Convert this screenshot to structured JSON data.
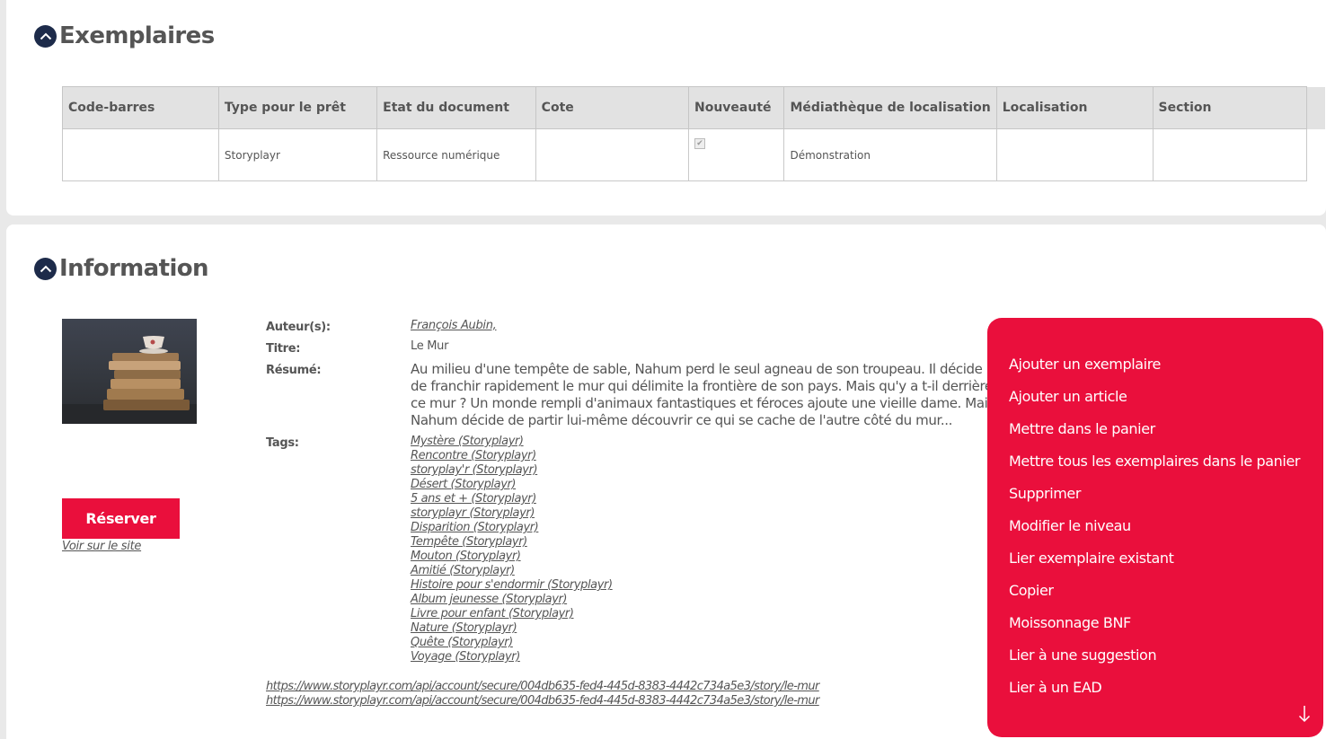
{
  "exemplaires": {
    "title": "Exemplaires",
    "columns": [
      "Code-barres",
      "Type pour le prêt",
      "Etat du document",
      "Cote",
      "Nouveauté",
      "Médiathèque de localisation",
      "Localisation",
      "Section"
    ],
    "rows": [
      {
        "code_barres": "",
        "type_pret": "Storyplayr",
        "etat": "Ressource numérique",
        "cote": "",
        "nouveaute_checked": true,
        "mediatheque": "Démonstration",
        "localisation": "",
        "section": ""
      }
    ]
  },
  "information": {
    "title": "Information",
    "labels": {
      "auteurs": "Auteur(s):",
      "titre": "Titre:",
      "resume": "Résumé:",
      "tags": "Tags:"
    },
    "auteur": "François Aubin,",
    "titre": "Le Mur",
    "resume": "Au milieu d'une tempête de sable, Nahum perd le seul agneau de son troupeau. Il décide de franchir rapidement le mur qui délimite la frontière de son pays. Mais qu'y a t-il derrière ce mur ? Un monde rempli d'animaux fantastiques et féroces ajoute une vieille dame. Mais Nahum décide de partir lui-même découvrir ce qui se cache de l'autre côté du mur...",
    "tags": [
      "Mystère (Storyplayr)",
      "Rencontre (Storyplayr)",
      "storyplay'r (Storyplayr)",
      "Désert (Storyplayr)",
      "5 ans et + (Storyplayr)",
      "storyplayr (Storyplayr)",
      "Disparition (Storyplayr)",
      "Tempête (Storyplayr)",
      "Mouton (Storyplayr)",
      "Amitié (Storyplayr)",
      "Histoire pour s'endormir (Storyplayr)",
      "Album jeunesse (Storyplayr)",
      "Livre pour enfant (Storyplayr)",
      "Nature (Storyplayr)",
      "Quête (Storyplayr)",
      "Voyage (Storyplayr)"
    ],
    "urls": [
      "https://www.storyplayr.com/api/account/secure/004db635-fed4-445d-8383-4442c734a5e3/story/le-mur",
      "https://www.storyplayr.com/api/account/secure/004db635-fed4-445d-8383-4442c734a5e3/story/le-mur"
    ],
    "reserve_label": "Réserver",
    "site_link": "Voir sur le site"
  },
  "menu": {
    "items": [
      "Ajouter un exemplaire",
      "Ajouter un article",
      "Mettre dans le panier",
      "Mettre tous les exemplaires dans le panier",
      "Supprimer",
      "Modifier le niveau",
      "Lier exemplaire existant",
      "Copier",
      "Moissonnage BNF",
      "Lier à une suggestion",
      "Lier à un EAD"
    ],
    "accent_color": "#ea0f3c"
  },
  "icons": {
    "collapse": "chevron-up-icon",
    "scroll": "arrow-down-icon"
  }
}
